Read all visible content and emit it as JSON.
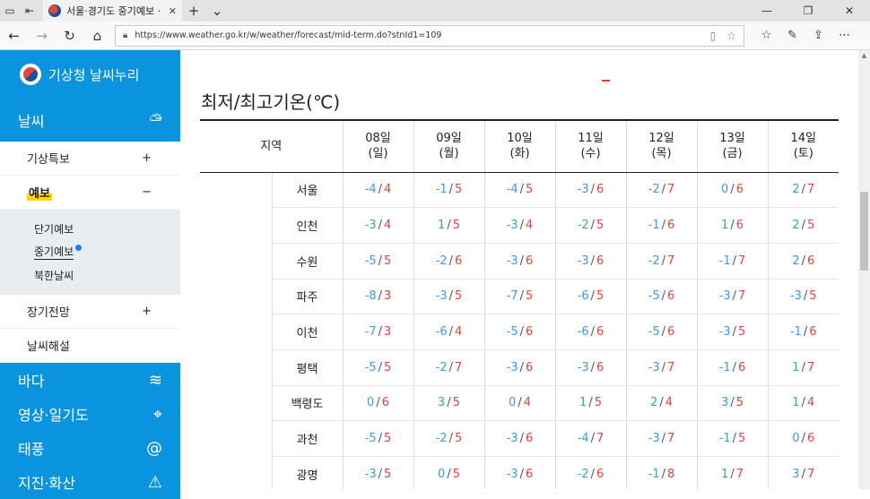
{
  "browser": {
    "tab_title": "서울·경기도 중기예보 ·",
    "url": "https://www.weather.go.kr/w/weather/forecast/mid-term.do?stnId1=109"
  },
  "sidebar": {
    "logo_text": "기상청 날씨누리",
    "sections": [
      {
        "label": "날씨",
        "icon": "cloud-sun-icon"
      },
      {
        "label": "바다",
        "icon": "wave-icon"
      },
      {
        "label": "영상·일기도",
        "icon": "radar-icon"
      },
      {
        "label": "태풍",
        "icon": "typhoon-icon"
      },
      {
        "label": "지진·화산",
        "icon": "earthquake-icon"
      }
    ],
    "weather_items": [
      {
        "label": "기상특보",
        "toggle": "+"
      },
      {
        "label": "예보",
        "toggle": "−"
      }
    ],
    "forecast_subitems": [
      "단기예보",
      "중기예보",
      "북한날씨"
    ],
    "more_items": [
      {
        "label": "장기전망",
        "toggle": "+"
      },
      {
        "label": "날씨해설",
        "toggle": ""
      }
    ]
  },
  "main": {
    "heading": "최저/최고기온(℃)",
    "region_header": "지역",
    "days": [
      {
        "date": "08일",
        "dow": "(일)"
      },
      {
        "date": "09일",
        "dow": "(월)"
      },
      {
        "date": "10일",
        "dow": "(화)"
      },
      {
        "date": "11일",
        "dow": "(수)"
      },
      {
        "date": "12일",
        "dow": "(목)"
      },
      {
        "date": "13일",
        "dow": "(금)"
      },
      {
        "date": "14일",
        "dow": "(토)"
      }
    ],
    "rows": [
      {
        "region": "서울",
        "temps": [
          [
            "-4",
            "4"
          ],
          [
            "-1",
            "5"
          ],
          [
            "-4",
            "5"
          ],
          [
            "-3",
            "6"
          ],
          [
            "-2",
            "7"
          ],
          [
            "0",
            "6"
          ],
          [
            "2",
            "7"
          ]
        ]
      },
      {
        "region": "인천",
        "temps": [
          [
            "-3",
            "4"
          ],
          [
            "1",
            "5"
          ],
          [
            "-3",
            "4"
          ],
          [
            "-2",
            "5"
          ],
          [
            "-1",
            "6"
          ],
          [
            "1",
            "6"
          ],
          [
            "2",
            "5"
          ]
        ]
      },
      {
        "region": "수원",
        "temps": [
          [
            "-5",
            "5"
          ],
          [
            "-2",
            "6"
          ],
          [
            "-3",
            "6"
          ],
          [
            "-3",
            "6"
          ],
          [
            "-2",
            "7"
          ],
          [
            "-1",
            "7"
          ],
          [
            "2",
            "6"
          ]
        ]
      },
      {
        "region": "파주",
        "temps": [
          [
            "-8",
            "3"
          ],
          [
            "-3",
            "5"
          ],
          [
            "-7",
            "5"
          ],
          [
            "-6",
            "5"
          ],
          [
            "-5",
            "6"
          ],
          [
            "-3",
            "7"
          ],
          [
            "-3",
            "5"
          ]
        ]
      },
      {
        "region": "이천",
        "temps": [
          [
            "-7",
            "3"
          ],
          [
            "-6",
            "4"
          ],
          [
            "-5",
            "6"
          ],
          [
            "-6",
            "6"
          ],
          [
            "-5",
            "6"
          ],
          [
            "-3",
            "5"
          ],
          [
            "-1",
            "6"
          ]
        ]
      },
      {
        "region": "평택",
        "temps": [
          [
            "-5",
            "5"
          ],
          [
            "-2",
            "7"
          ],
          [
            "-3",
            "6"
          ],
          [
            "-3",
            "6"
          ],
          [
            "-3",
            "7"
          ],
          [
            "-1",
            "6"
          ],
          [
            "1",
            "7"
          ]
        ]
      },
      {
        "region": "백령도",
        "temps": [
          [
            "0",
            "6"
          ],
          [
            "3",
            "5"
          ],
          [
            "0",
            "4"
          ],
          [
            "1",
            "5"
          ],
          [
            "2",
            "4"
          ],
          [
            "3",
            "5"
          ],
          [
            "1",
            "4"
          ]
        ]
      },
      {
        "region": "과천",
        "temps": [
          [
            "-5",
            "5"
          ],
          [
            "-2",
            "5"
          ],
          [
            "-3",
            "6"
          ],
          [
            "-4",
            "7"
          ],
          [
            "-3",
            "7"
          ],
          [
            "-1",
            "5"
          ],
          [
            "0",
            "6"
          ]
        ]
      },
      {
        "region": "광명",
        "temps": [
          [
            "-3",
            "5"
          ],
          [
            "0",
            "5"
          ],
          [
            "-3",
            "6"
          ],
          [
            "-2",
            "6"
          ],
          [
            "-1",
            "8"
          ],
          [
            "1",
            "7"
          ],
          [
            "3",
            "7"
          ]
        ]
      }
    ]
  },
  "colors": {
    "accent": "#0a93de",
    "low": "#3d9be0",
    "high": "#e2433c",
    "highlight": "#ffd800"
  }
}
